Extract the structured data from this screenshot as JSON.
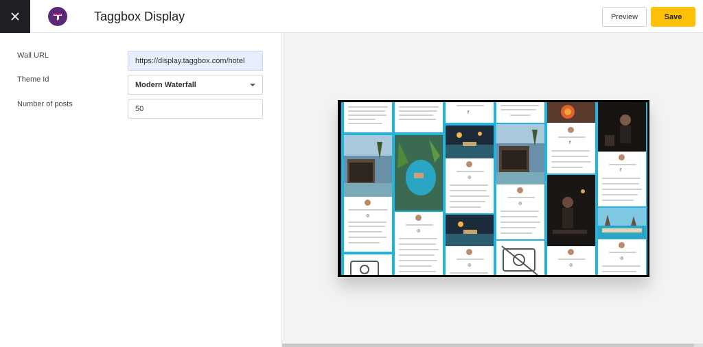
{
  "header": {
    "close_icon": "close-icon",
    "logo_icon": "taggbox-logo",
    "title": "Taggbox Display",
    "preview_label": "Preview",
    "save_label": "Save",
    "save_color": "#ffc107"
  },
  "form": {
    "wall_url": {
      "label": "Wall URL",
      "value": "https://display.taggbox.com/hotel"
    },
    "theme_id": {
      "label": "Theme Id",
      "value": "Modern Waterfall"
    },
    "num_posts": {
      "label": "Number of posts",
      "value": "50"
    }
  },
  "preview": {
    "wall_bg_color": "#22b4e0",
    "social_icons": [
      "facebook-icon",
      "instagram-icon"
    ]
  }
}
